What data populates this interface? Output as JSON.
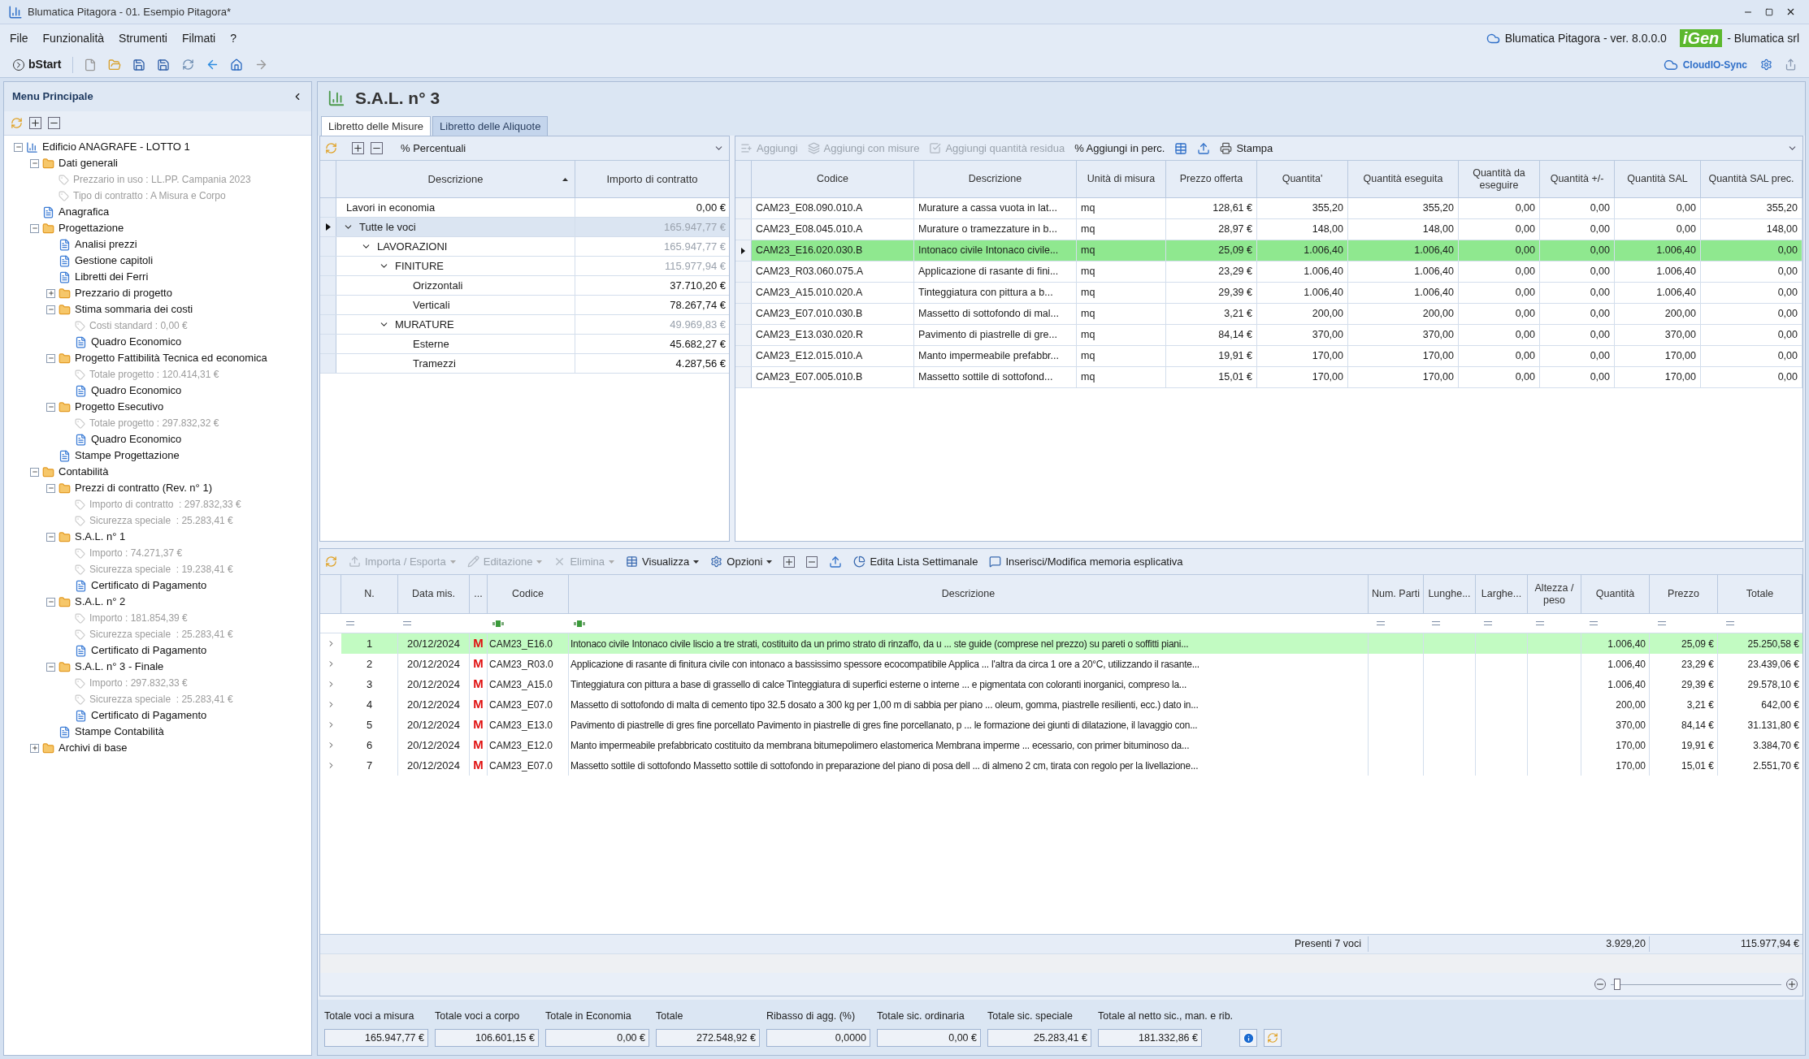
{
  "window": {
    "title": "Blumatica Pitagora - 01. Esempio Pitagora*"
  },
  "menu": {
    "items": [
      "File",
      "Funzionalità",
      "Strumenti",
      "Filmati",
      "?"
    ],
    "version": "Blumatica Pitagora - ver. 8.0.0.0",
    "logo": "iGen",
    "company": "- Blumatica srl"
  },
  "toolbar": {
    "start": "bStart",
    "sync": "CloudIO-Sync"
  },
  "sidebar": {
    "title": "Menu Principale",
    "tree": [
      {
        "label": "Edificio ANAGRAFE - LOTTO 1",
        "kind": "item",
        "expanded": true,
        "children": [
          {
            "label": "Dati generali",
            "kind": "item",
            "expanded": true,
            "children": [
              {
                "label": "Prezzario in uso : LL.PP. Campania 2023",
                "kind": "info"
              },
              {
                "label": "Tipo di contratto : A Misura e Corpo",
                "kind": "info"
              }
            ]
          },
          {
            "label": "Anagrafica",
            "kind": "item"
          },
          {
            "label": "Progettazione",
            "kind": "item",
            "expanded": true,
            "children": [
              {
                "label": "Analisi prezzi",
                "kind": "item"
              },
              {
                "label": "Gestione capitoli",
                "kind": "item"
              },
              {
                "label": "Libretti dei Ferri",
                "kind": "item"
              },
              {
                "label": "Prezzario di progetto",
                "kind": "item",
                "expanded": false
              },
              {
                "label": "Stima sommaria dei costi",
                "kind": "item",
                "expanded": true,
                "children": [
                  {
                    "label": "Costi standard : 0,00 €",
                    "kind": "info"
                  },
                  {
                    "label": "Quadro Economico",
                    "kind": "item"
                  }
                ]
              },
              {
                "label": "Progetto Fattibilità Tecnica ed economica",
                "kind": "item",
                "expanded": true,
                "children": [
                  {
                    "label": "Totale progetto : 120.414,31 €",
                    "kind": "info"
                  },
                  {
                    "label": "Quadro Economico",
                    "kind": "item"
                  }
                ]
              },
              {
                "label": "Progetto Esecutivo",
                "kind": "item",
                "expanded": true,
                "children": [
                  {
                    "label": "Totale progetto : 297.832,32 €",
                    "kind": "info"
                  },
                  {
                    "label": "Quadro Economico",
                    "kind": "item"
                  }
                ]
              },
              {
                "label": "Stampe Progettazione",
                "kind": "item"
              }
            ]
          },
          {
            "label": "Contabilità",
            "kind": "item",
            "expanded": true,
            "children": [
              {
                "label": "Prezzi di contratto (Rev. n° 1)",
                "kind": "item",
                "expanded": true,
                "children": [
                  {
                    "label": "Importo di contratto  : 297.832,33 €",
                    "kind": "info"
                  },
                  {
                    "label": "Sicurezza speciale  : 25.283,41 €",
                    "kind": "info"
                  }
                ]
              },
              {
                "label": "S.A.L. n° 1",
                "kind": "item",
                "expanded": true,
                "children": [
                  {
                    "label": "Importo : 74.271,37 €",
                    "kind": "info"
                  },
                  {
                    "label": "Sicurezza speciale  : 19.238,41 €",
                    "kind": "info"
                  },
                  {
                    "label": "Certificato di Pagamento",
                    "kind": "item"
                  }
                ]
              },
              {
                "label": "S.A.L. n° 2",
                "kind": "item",
                "expanded": true,
                "children": [
                  {
                    "label": "Importo : 181.854,39 €",
                    "kind": "info"
                  },
                  {
                    "label": "Sicurezza speciale  : 25.283,41 €",
                    "kind": "info"
                  },
                  {
                    "label": "Certificato di Pagamento",
                    "kind": "item"
                  }
                ]
              },
              {
                "label": "S.A.L. n° 3 - Finale",
                "kind": "item",
                "expanded": true,
                "children": [
                  {
                    "label": "Importo : 297.832,33 €",
                    "kind": "info"
                  },
                  {
                    "label": "Sicurezza speciale  : 25.283,41 €",
                    "kind": "info"
                  },
                  {
                    "label": "Certificato di Pagamento",
                    "kind": "item"
                  }
                ]
              },
              {
                "label": "Stampe Contabilità",
                "kind": "item"
              }
            ]
          },
          {
            "label": "Archivi di base",
            "kind": "item",
            "expanded": false
          }
        ]
      }
    ]
  },
  "page": {
    "title": "S.A.L. n° 3",
    "tabs": [
      {
        "label": "Libretto delle Misure",
        "selected": true
      },
      {
        "label": "Libretto delle Aliquote",
        "selected": false
      }
    ]
  },
  "categories": {
    "toolbar": {
      "glyph": "%",
      "label": "Percentuali"
    },
    "columns": [
      "Descrizione",
      "Importo di contratto"
    ],
    "rows": [
      {
        "label": "Lavori in economia",
        "amount": "0,00 €",
        "kind": "leaf",
        "selected": false
      },
      {
        "label": "Tutte le voci",
        "amount": "165.947,77 €",
        "kind": "group",
        "expanded": true,
        "selected": true,
        "children": [
          {
            "label": "LAVORAZIONI",
            "amount": "165.947,77 €",
            "kind": "group",
            "expanded": true,
            "selected": false,
            "children": [
              {
                "label": "FINITURE",
                "amount": "115.977,94 €",
                "kind": "group",
                "expanded": true,
                "selected": false,
                "children": [
                  {
                    "label": "Orizzontali",
                    "amount": "37.710,20 €",
                    "kind": "leaf",
                    "selected": false
                  },
                  {
                    "label": "Verticali",
                    "amount": "78.267,74 €",
                    "kind": "leaf",
                    "selected": false
                  }
                ]
              },
              {
                "label": "MURATURE",
                "amount": "49.969,83 €",
                "kind": "group",
                "expanded": true,
                "selected": false,
                "children": [
                  {
                    "label": "Esterne",
                    "amount": "45.682,27 €",
                    "kind": "leaf",
                    "selected": false
                  },
                  {
                    "label": "Tramezzi",
                    "amount": "4.287,56 €",
                    "kind": "leaf",
                    "selected": false
                  }
                ]
              }
            ]
          }
        ]
      }
    ]
  },
  "items": {
    "toolbar": [
      {
        "label": "Aggiungi",
        "disabled": true
      },
      {
        "label": "Aggiungi con misure",
        "disabled": true
      },
      {
        "label": "Aggiungi quantità residua",
        "disabled": true
      },
      {
        "glyph": "%",
        "label": "Aggiungi in perc.",
        "disabled": false
      },
      {
        "label": "Stampa",
        "disabled": false
      }
    ],
    "columns": [
      "Codice",
      "Descrizione",
      "Unità di misura",
      "Prezzo offerta",
      "Quantita'",
      "Quantità eseguita",
      "Quantità da eseguire",
      "Quantità +/-",
      "Quantità SAL",
      "Quantità SAL prec."
    ],
    "rows": [
      {
        "selected": false,
        "cells": [
          "CAM23_E08.090.010.A",
          "Murature a cassa vuota in lat...",
          "mq",
          "128,61 €",
          "355,20",
          "355,20",
          "0,00",
          "0,00",
          "0,00",
          "355,20"
        ]
      },
      {
        "selected": false,
        "cells": [
          "CAM23_E08.045.010.A",
          "Murature o tramezzature in b...",
          "mq",
          "28,97 €",
          "148,00",
          "148,00",
          "0,00",
          "0,00",
          "0,00",
          "148,00"
        ]
      },
      {
        "selected": true,
        "cells": [
          "CAM23_E16.020.030.B",
          "Intonaco civile Intonaco civile...",
          "mq",
          "25,09 €",
          "1.006,40",
          "1.006,40",
          "0,00",
          "0,00",
          "1.006,40",
          "0,00"
        ]
      },
      {
        "selected": false,
        "cells": [
          "CAM23_R03.060.075.A",
          "Applicazione di rasante di fini...",
          "mq",
          "23,29 €",
          "1.006,40",
          "1.006,40",
          "0,00",
          "0,00",
          "1.006,40",
          "0,00"
        ]
      },
      {
        "selected": false,
        "cells": [
          "CAM23_A15.010.020.A",
          "Tinteggiatura con pittura a b...",
          "mq",
          "29,39 €",
          "1.006,40",
          "1.006,40",
          "0,00",
          "0,00",
          "1.006,40",
          "0,00"
        ]
      },
      {
        "selected": false,
        "cells": [
          "CAM23_E07.010.030.B",
          "Massetto di sottofondo di mal...",
          "mq",
          "3,21 €",
          "200,00",
          "200,00",
          "0,00",
          "0,00",
          "200,00",
          "0,00"
        ]
      },
      {
        "selected": false,
        "cells": [
          "CAM23_E13.030.020.R",
          "Pavimento di piastrelle di gre...",
          "mq",
          "84,14 €",
          "370,00",
          "370,00",
          "0,00",
          "0,00",
          "370,00",
          "0,00"
        ]
      },
      {
        "selected": false,
        "cells": [
          "CAM23_E12.015.010.A",
          "Manto impermeabile prefabbr...",
          "mq",
          "19,91 €",
          "170,00",
          "170,00",
          "0,00",
          "0,00",
          "170,00",
          "0,00"
        ]
      },
      {
        "selected": false,
        "cells": [
          "CAM23_E07.005.010.B",
          "Massetto sottile di sottofond...",
          "mq",
          "15,01 €",
          "170,00",
          "170,00",
          "0,00",
          "0,00",
          "170,00",
          "0,00"
        ]
      }
    ]
  },
  "measures": {
    "toolbar": [
      {
        "label": "Importa / Esporta",
        "disabled": true,
        "dropdown": true
      },
      {
        "label": "Editazione",
        "disabled": true,
        "dropdown": true
      },
      {
        "label": "Elimina",
        "disabled": true,
        "dropdown": true
      },
      {
        "label": "Visualizza",
        "disabled": false,
        "dropdown": true
      },
      {
        "label": "Opzioni",
        "disabled": false,
        "dropdown": true
      },
      {
        "label": "Edita Lista Settimanale",
        "disabled": false,
        "dropdown": false
      },
      {
        "label": "Inserisci/Modifica memoria esplicativa",
        "disabled": false,
        "dropdown": false
      }
    ],
    "columns": [
      "N.",
      "Data mis.",
      "...",
      "Codice",
      "Descrizione",
      "Num. Parti",
      "Lunghe...",
      "Larghe...",
      "Altezza / peso",
      "Quantità",
      "Prezzo",
      "Totale"
    ],
    "rows": [
      {
        "selected": true,
        "n": "1",
        "date": "20/12/2024",
        "marker": "M",
        "code": "CAM23_E16.0",
        "description": "Intonaco civile Intonaco civile liscio a tre strati, costituito da un primo strato di rinzaffo, da u ... ste guide (comprese nel prezzo) su pareti o soffitti piani...",
        "quantity": "1.006,40",
        "price": "25,09 €",
        "total": "25.250,58 €"
      },
      {
        "selected": false,
        "n": "2",
        "date": "20/12/2024",
        "marker": "M",
        "code": "CAM23_R03.0",
        "description": "Applicazione di rasante di finitura civile con intonaco a bassissimo spessore ecocompatibile Applica ... l'altra da circa 1 ore a 20°C, utilizzando il rasante...",
        "quantity": "1.006,40",
        "price": "23,29 €",
        "total": "23.439,06 €"
      },
      {
        "selected": false,
        "n": "3",
        "date": "20/12/2024",
        "marker": "M",
        "code": "CAM23_A15.0",
        "description": "Tinteggiatura con pittura a base di grassello di calce Tinteggiatura di superfici esterne o interne ... e pigmentata con coloranti inorganici, compreso la...",
        "quantity": "1.006,40",
        "price": "29,39 €",
        "total": "29.578,10 €"
      },
      {
        "selected": false,
        "n": "4",
        "date": "20/12/2024",
        "marker": "M",
        "code": "CAM23_E07.0",
        "description": "Massetto di sottofondo di malta di cemento tipo 32.5 dosato a 300 kg per 1,00 m di sabbia per piano ... oleum, gomma, piastrelle resilienti, ecc.) dato in...",
        "quantity": "200,00",
        "price": "3,21 €",
        "total": "642,00 €"
      },
      {
        "selected": false,
        "n": "5",
        "date": "20/12/2024",
        "marker": "M",
        "code": "CAM23_E13.0",
        "description": "Pavimento di piastrelle di gres fine porcellato Pavimento in piastrelle di gres fine porcellanato, p ... le formazione dei giunti di dilatazione, il lavaggio con...",
        "quantity": "370,00",
        "price": "84,14 €",
        "total": "31.131,80 €"
      },
      {
        "selected": false,
        "n": "6",
        "date": "20/12/2024",
        "marker": "M",
        "code": "CAM23_E12.0",
        "description": "Manto impermeabile prefabbricato costituito da membrana bitumepolimero elastomerica Membrana imperme ... ecessario, con primer bituminoso da...",
        "quantity": "170,00",
        "price": "19,91 €",
        "total": "3.384,70 €"
      },
      {
        "selected": false,
        "n": "7",
        "date": "20/12/2024",
        "marker": "M",
        "code": "CAM23_E07.0",
        "description": "Massetto sottile di sottofondo Massetto sottile di sottofondo in preparazione del piano di posa dell ... di almeno 2 cm, tirata con regolo per la livellazione...",
        "quantity": "170,00",
        "price": "15,01 €",
        "total": "2.551,70 €"
      }
    ],
    "footer": {
      "count": "Presenti 7 voci",
      "quantity": "3.929,20",
      "total": "115.977,94 €"
    },
    "zoom": {
      "level": 0.02
    }
  },
  "totals": [
    {
      "label": "Totale voci a misura",
      "value": "165.947,77 €"
    },
    {
      "label": "Totale voci a corpo",
      "value": "106.601,15 €"
    },
    {
      "label": "Totale in Economia",
      "value": "0,00 €"
    },
    {
      "label": "Totale",
      "value": "272.548,92 €"
    },
    {
      "label": "Ribasso di agg. (%)",
      "value": "0,0000"
    },
    {
      "label": "Totale sic. ordinaria",
      "value": "0,00 €"
    },
    {
      "label": "Totale sic. speciale",
      "value": "25.283,41 €"
    },
    {
      "label": "Totale al netto sic., man. e rib.",
      "value": "181.332,86 €"
    }
  ]
}
